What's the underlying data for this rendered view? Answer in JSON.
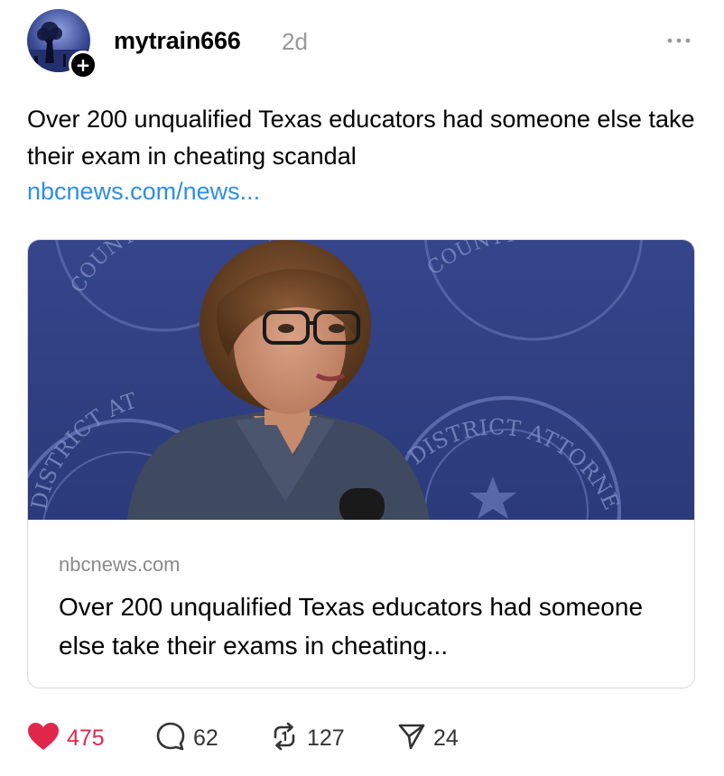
{
  "post": {
    "username": "mytrain666",
    "timestamp": "2d",
    "text": "Over 200 unqualified Texas educators had someone else take their exam in cheating scandal",
    "link_text": "nbcnews.com/news..."
  },
  "card": {
    "domain": "nbcnews.com",
    "title": "Over 200 unqualified Texas educators had someone else take their exams in cheating...",
    "seal_left_text": "COUNTY",
    "seal_right_text": "COUNTY",
    "seal_bottom_left_text": "DISTRICT AT",
    "seal_bottom_right_text": "DISTRICT ATTORNEY"
  },
  "actions": {
    "likes": "475",
    "comments": "62",
    "reposts": "127",
    "shares": "24"
  },
  "colors": {
    "like": "#e0274a",
    "link": "#2e8ee6",
    "timestamp": "#999999",
    "image_background": "#2f3f7d"
  },
  "icons": [
    "follow-plus-icon",
    "more-icon",
    "heart-icon",
    "comment-icon",
    "repost-icon",
    "share-icon"
  ]
}
